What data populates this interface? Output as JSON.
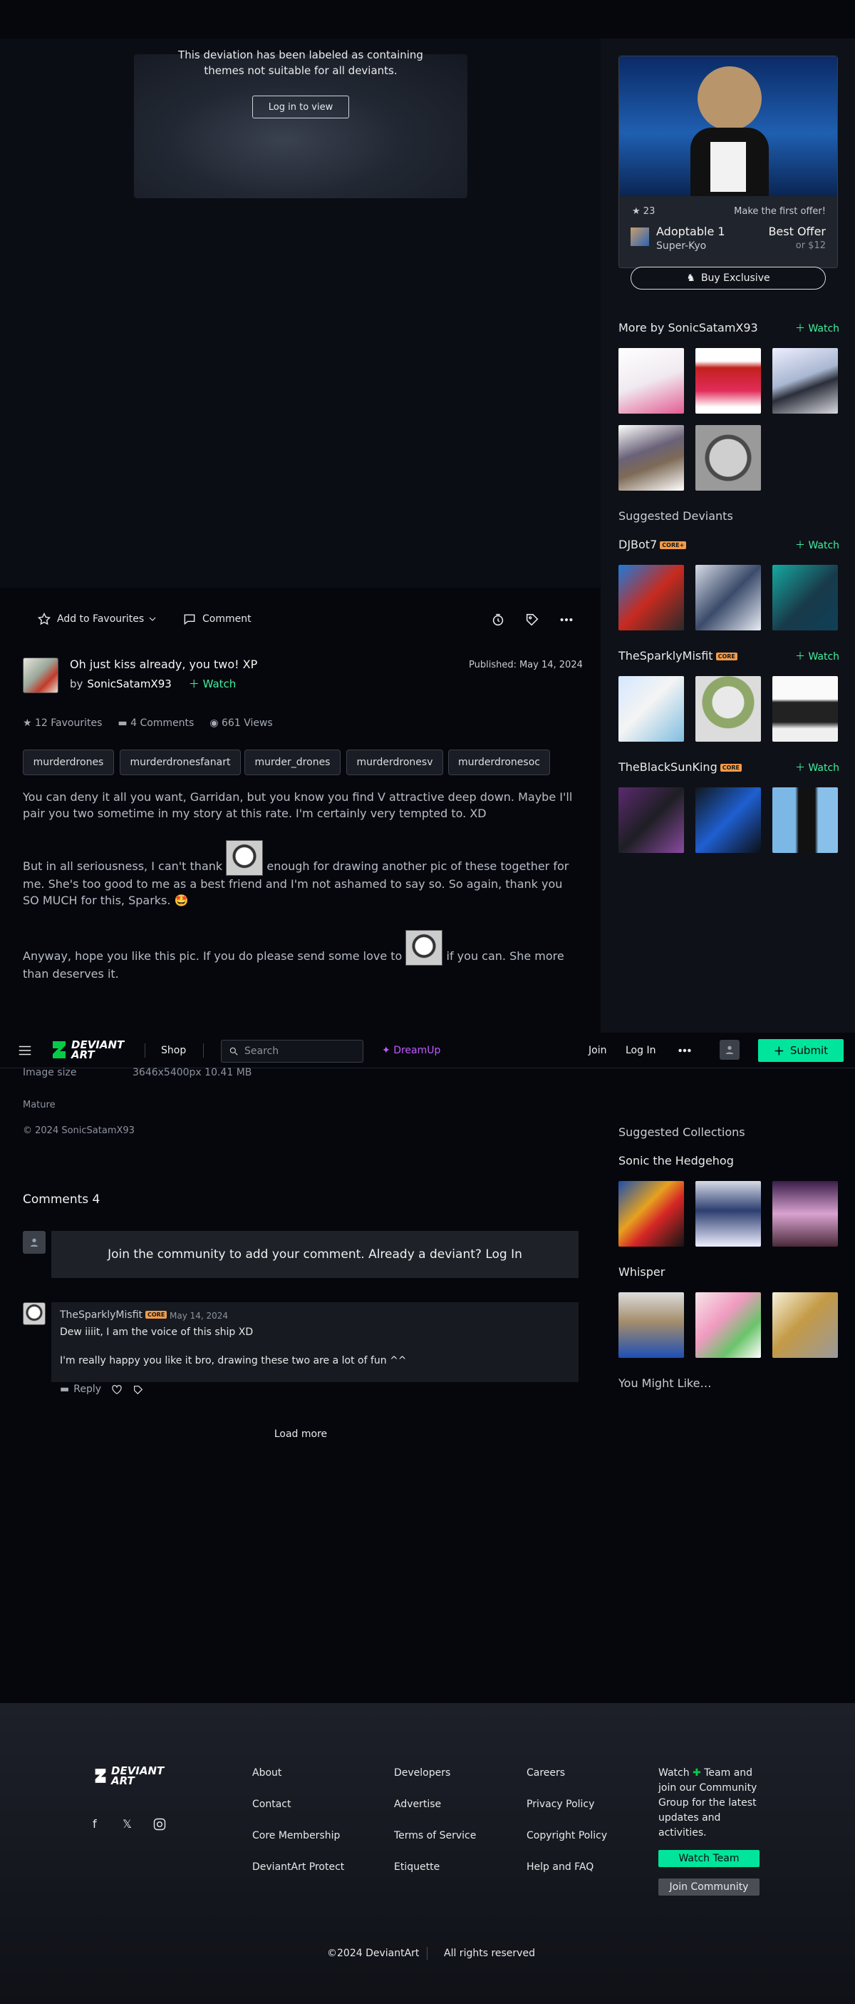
{
  "deviation": {
    "mature_message": "This deviation has been labeled as containing themes not suitable for all deviants.",
    "login_button": "Log in to view",
    "actions": {
      "favourite": "Add to Favourites",
      "comment": "Comment"
    },
    "title": "Oh just kiss already, you two! XP",
    "by": "by",
    "author": "SonicSatamX93",
    "watch": "Watch",
    "published_label": "Published:",
    "published_date": "May 14, 2024",
    "stats": {
      "favourites": "12 Favourites",
      "comments": "4 Comments",
      "views": "661 Views"
    },
    "tags": [
      "murderdrones",
      "murderdronesfanart",
      "murder_drones",
      "murderdronesv",
      "murderdronesoc"
    ],
    "description": [
      "You can deny it all you want, Garridan, but you know you find V attractive deep down. Maybe I'll pair you two sometime in my story at this rate. I'm certainly very tempted to. XD",
      "But in all seriousness, I can't thank",
      "enough for drawing another pic of these together for me. She's too good to me as  a best friend and I'm not ashamed to say so. So again, thank you SO MUCH for this, Sparks. 🤩",
      "Anyway, hope you like this pic. If you do please send some love to",
      "if you can. She more than deserves it."
    ],
    "details": {
      "size_label": "Image size",
      "size_value": "3646x5400px 10.41 MB",
      "mature": "Mature",
      "copyright": "© 2024 SonicSatamX93"
    }
  },
  "nav": {
    "shop": "Shop",
    "search_placeholder": "Search",
    "dreamup": "DreamUp",
    "join": "Join",
    "login": "Log In",
    "submit": "Submit"
  },
  "sidebar": {
    "offer": {
      "likes": "23",
      "make_offer": "Make the first offer!",
      "name": "Adoptable 1",
      "seller": "Super-Kyo",
      "best_offer": "Best Offer",
      "or_price": "or $12",
      "buy": "Buy Exclusive"
    },
    "more_by": "More by SonicSatamX93",
    "watch": "Watch",
    "suggested_deviants": "Suggested Deviants",
    "deviants": [
      {
        "name": "DJBot7",
        "badge": "CORE+"
      },
      {
        "name": "TheSparklyMisfit",
        "badge": "CORE"
      },
      {
        "name": "TheBlackSunKing",
        "badge": "CORE"
      }
    ],
    "suggested_collections": "Suggested Collections",
    "collections": [
      "Sonic the Hedgehog",
      "Whisper"
    ],
    "you_might_like": "You Might Like…"
  },
  "comments": {
    "heading": "Comments 4",
    "join_prompt": "Join the community to add your comment. Already a deviant? Log In",
    "items": [
      {
        "author": "TheSparklyMisfit",
        "badge": "CORE",
        "date": "May 14, 2024",
        "lines": [
          "Dew iiiit, I am the voice of this ship XD",
          "I'm really happy you like it bro, drawing these two are a lot of fun ^^"
        ],
        "reply": "Reply"
      }
    ],
    "load_more": "Load more"
  },
  "footer": {
    "col1": [
      "About",
      "Contact",
      "Core Membership",
      "DeviantArt Protect"
    ],
    "col2": [
      "Developers",
      "Advertise",
      "Terms of Service",
      "Etiquette"
    ],
    "col3": [
      "Careers",
      "Privacy Policy",
      "Copyright Policy",
      "Help and FAQ"
    ],
    "watch_text_a": "Watch",
    "watch_text_b": "Team and join our Community Group for the latest updates and activities.",
    "watch_team": "Watch Team",
    "join_community": "Join Community",
    "copyright": "©2024 DeviantArt",
    "rights": "All rights reserved"
  },
  "colors": {
    "accent": "#00e59b",
    "dreamup": "#c259ff",
    "core_badge": "#f49b48"
  }
}
